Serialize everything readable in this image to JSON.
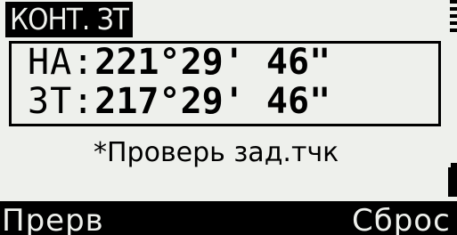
{
  "screen_title": "КОНТ. ЗТ",
  "angles": [
    {
      "label": "HA:",
      "value": "221°29' 46\""
    },
    {
      "label": "ЗТ:",
      "value": "217°29' 46\""
    }
  ],
  "message": "*Проверь зад.тчк",
  "softkeys": {
    "left": "Прерв",
    "right": "Сброс"
  },
  "icons": {
    "scroll": "scroll-indicator-icon",
    "battery": "battery-icon"
  }
}
